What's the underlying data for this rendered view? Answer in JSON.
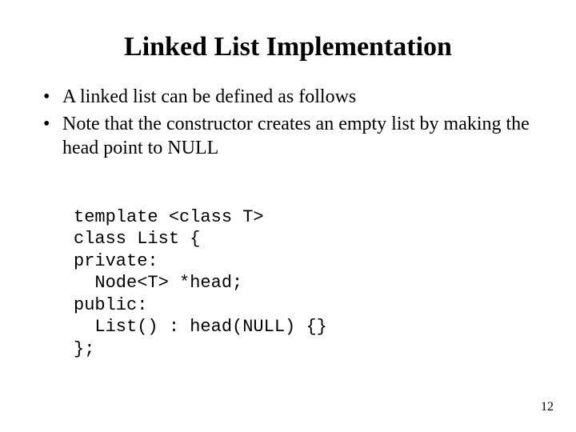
{
  "title": "Linked List Implementation",
  "bullets": [
    "A linked list can be defined as follows",
    "Note that the constructor creates an empty list by making the head point to NULL"
  ],
  "code": {
    "l1": "template <class T>",
    "l2": "class List {",
    "l3": "private:",
    "l4": "  Node<T> *head;",
    "l5": "public:",
    "l6": "  List() : head(NULL) {}",
    "l7": "};"
  },
  "page_number": "12"
}
